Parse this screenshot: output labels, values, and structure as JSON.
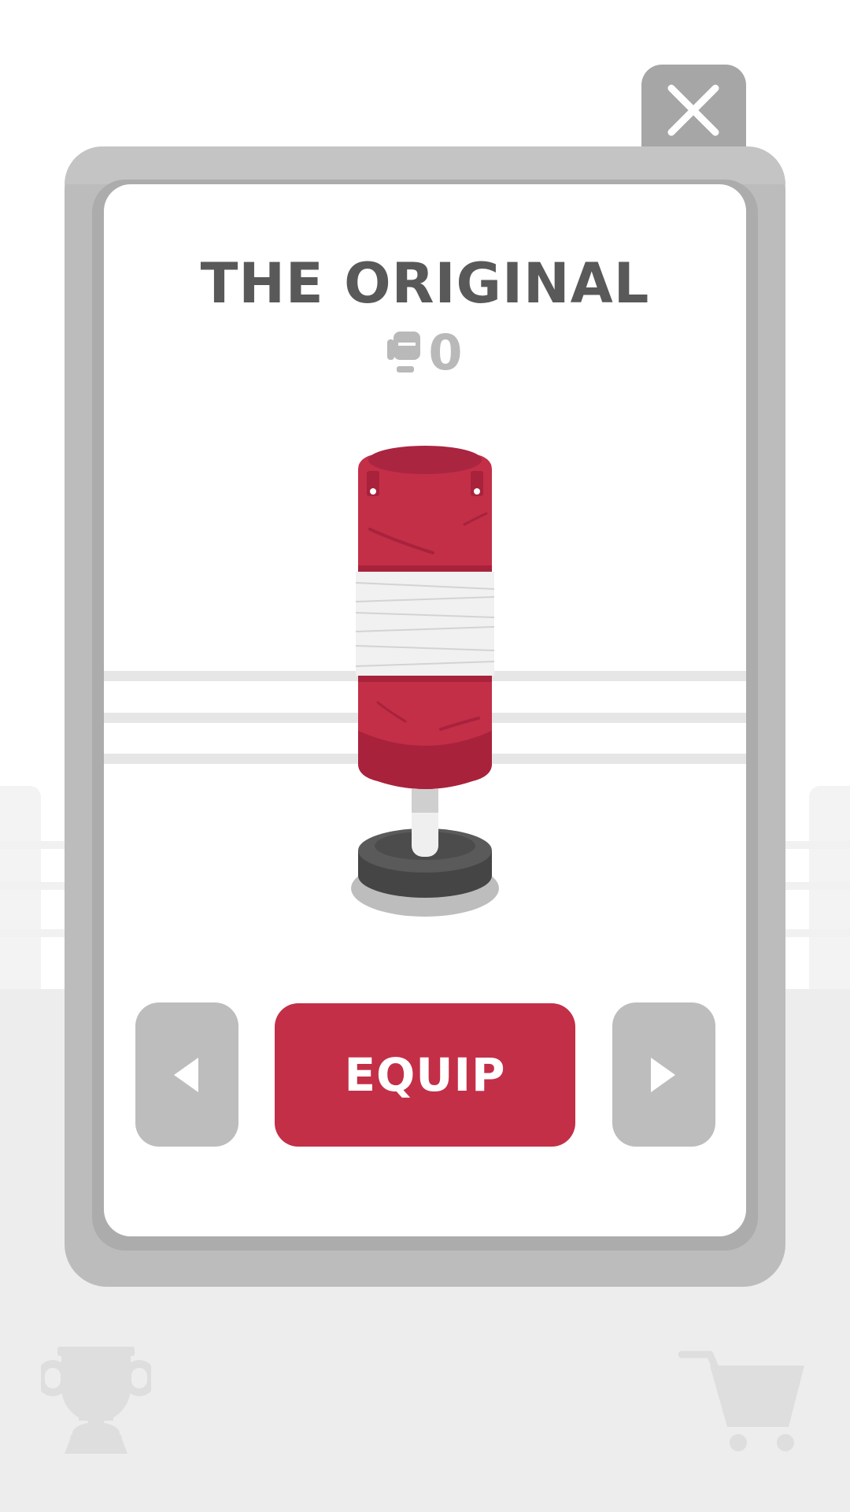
{
  "modal": {
    "title": "THE ORIGINAL",
    "price": "0",
    "price_icon": "boxing-glove-icon",
    "item_icon": "punching-bag-icon",
    "equip_label": "EQUIP",
    "prev_icon": "triangle-left-icon",
    "next_icon": "triangle-right-icon",
    "close_icon": "close-icon"
  },
  "footer": {
    "left_icon": "trophy-icon",
    "right_icon": "cart-icon"
  },
  "colors": {
    "accent": "#c32f47",
    "frame": "#bcbcbc",
    "text": "#595959",
    "muted": "#b9b9b9"
  }
}
